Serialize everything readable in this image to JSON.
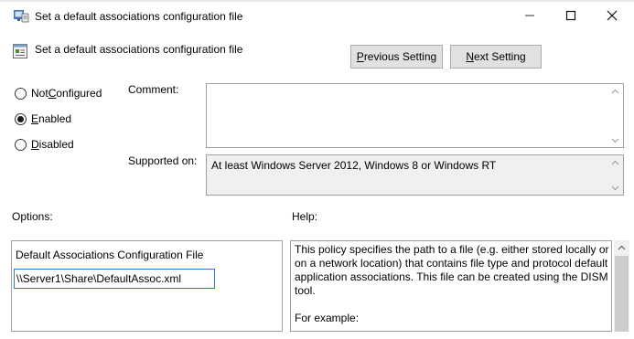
{
  "window": {
    "title": "Set a default associations configuration file",
    "app_icon": "group-policy-editor-icon",
    "minimize_icon": "minimize-icon",
    "maximize_icon": "maximize-icon",
    "close_icon": "close-icon"
  },
  "header": {
    "title": "Set a default associations configuration file",
    "icon": "policy-setting-icon",
    "previous_button": {
      "prefix": "",
      "mnemonic": "P",
      "rest": "revious Setting"
    },
    "next_button": {
      "prefix": "",
      "mnemonic": "N",
      "rest": "ext Setting"
    }
  },
  "state": {
    "options": [
      {
        "prefix": "Not ",
        "mnemonic": "C",
        "rest": "onfigured",
        "checked": false
      },
      {
        "prefix": "",
        "mnemonic": "E",
        "rest": "nabled",
        "checked": true
      },
      {
        "prefix": "",
        "mnemonic": "D",
        "rest": "isabled",
        "checked": false
      }
    ]
  },
  "comment": {
    "label": "Comment:",
    "value": ""
  },
  "supported_on": {
    "label": "Supported on:",
    "value": "At least Windows Server 2012, Windows 8 or Windows RT"
  },
  "options": {
    "header": "Options:",
    "field_label": "Default Associations Configuration File",
    "field_value": "\\\\Server1\\Share\\DefaultAssoc.xml"
  },
  "help": {
    "header": "Help:",
    "paragraphs": [
      "This policy specifies the path to a file (e.g. either stored locally or on a network location) that contains file type and protocol default application associations. This file can be created using the DISM tool.",
      "For example:"
    ]
  },
  "colors": {
    "button_face": "#e1e1e1",
    "button_border": "#adadad",
    "input_focus_border": "#2f7bd0",
    "readonly_background": "#f0f0f0"
  }
}
